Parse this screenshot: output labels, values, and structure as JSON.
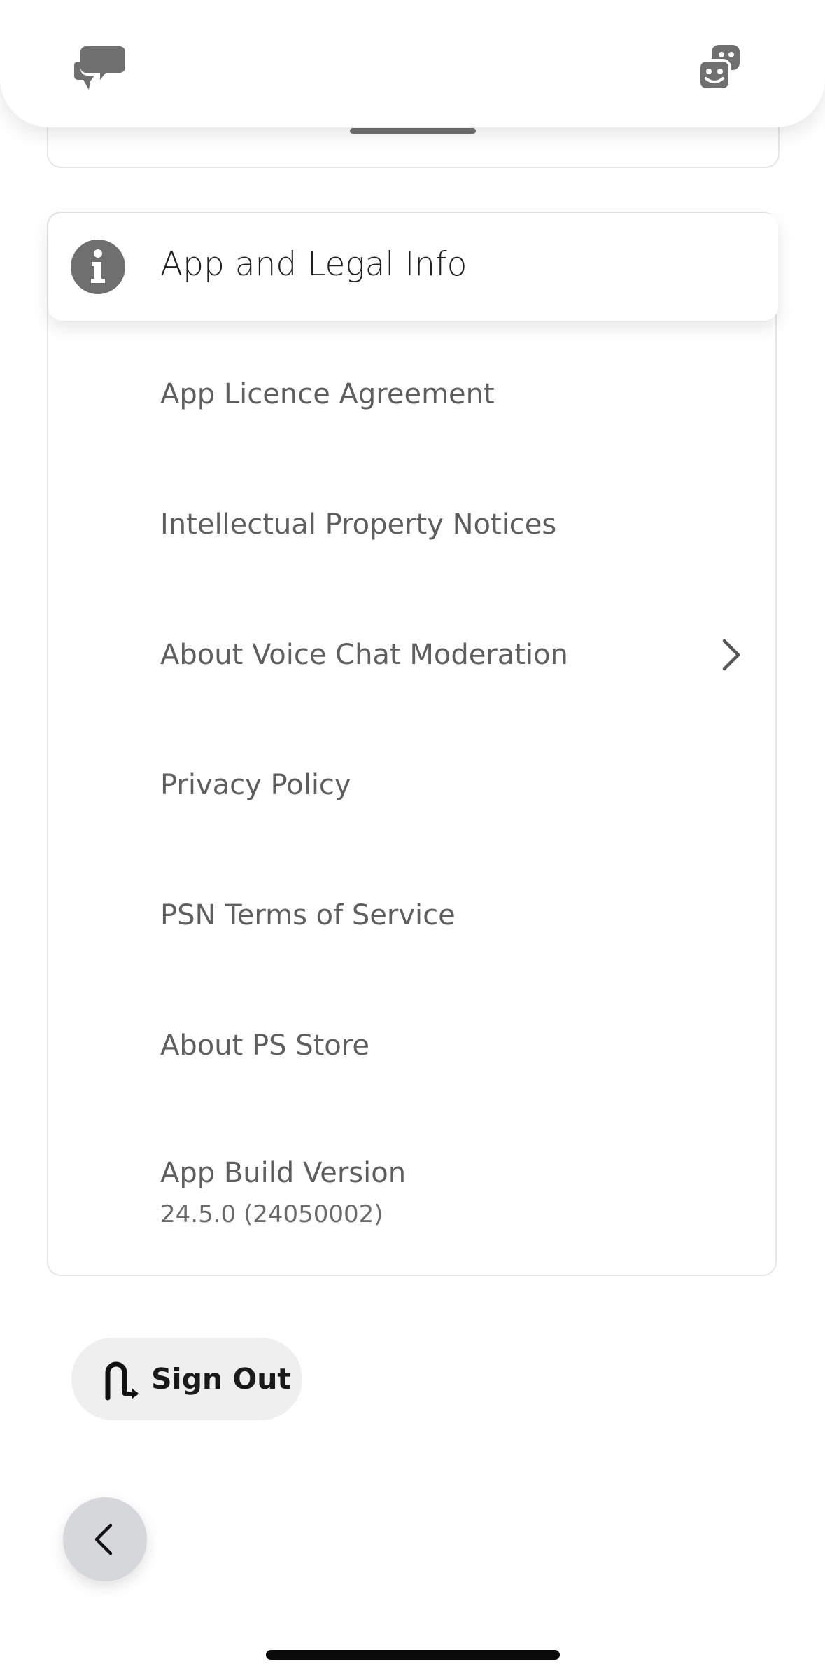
{
  "top_bar": {
    "left_icon": "chat-bubbles-icon",
    "right_icon": "party-faces-icon"
  },
  "section": {
    "icon": "info-icon",
    "title": "App and Legal Info",
    "items": [
      {
        "label": "App Licence Agreement"
      },
      {
        "label": "Intellectual Property Notices"
      },
      {
        "label": "About Voice Chat Moderation",
        "has_chevron": true
      },
      {
        "label": "Privacy Policy"
      },
      {
        "label": "PSN Terms of Service"
      },
      {
        "label": "About PS Store"
      }
    ],
    "version": {
      "label": "App Build Version",
      "value": "24.5.0 (24050002)"
    }
  },
  "sign_out": {
    "icon": "sign-out-icon",
    "label": "Sign Out"
  },
  "back": {
    "icon": "chevron-left-icon"
  },
  "colors": {
    "text_primary": "#1f1f1f",
    "text_secondary": "#5e5e5e",
    "icon_gray": "#6f6f6f",
    "button_bg": "#efefef",
    "back_button_bg": "#d6d7db"
  }
}
